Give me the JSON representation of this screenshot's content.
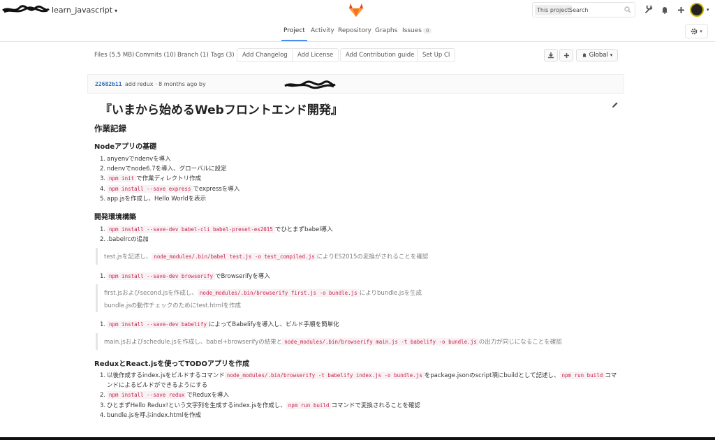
{
  "header": {
    "project_name": "learn_javascript",
    "search_scope": "This project",
    "search_placeholder": "Search"
  },
  "nav": {
    "tabs": [
      {
        "label": "Project"
      },
      {
        "label": "Activity"
      },
      {
        "label": "Repository"
      },
      {
        "label": "Graphs"
      },
      {
        "label": "Issues"
      }
    ],
    "issues_count": "0"
  },
  "stats": {
    "files": "Files (5.5 MB)",
    "commits": "Commits (10)",
    "branch": "Branch (1)",
    "tags": "Tags (3)"
  },
  "actions": {
    "add_changelog": "Add Changelog",
    "add_license": "Add License",
    "add_contribution": "Add Contribution guide",
    "setup_ci": "Set Up CI",
    "global": "Global"
  },
  "commit": {
    "sha": "22682b11",
    "message": "add redux · 8 months ago by"
  },
  "readme": {
    "title": "『いまから始めるWebフロントエンド開発』",
    "h_record": "作業記録",
    "h_node": "Nodeアプリの基礎",
    "node_items": [
      {
        "n": "1.",
        "pre": "anyenvでndenvを導入",
        "code": "",
        "post": ""
      },
      {
        "n": "2.",
        "pre": "ndenvでnode6.7を導入、グローバルに設定",
        "code": "",
        "post": ""
      },
      {
        "n": "3.",
        "pre": "",
        "code": "npm init",
        "post": "で作業ディレクトリ作成"
      },
      {
        "n": "4.",
        "pre": "",
        "code": "npm install --save express",
        "post": "でexpressを導入"
      },
      {
        "n": "5.",
        "pre": "app.jsを作成し、Hello Worldを表示",
        "code": "",
        "post": ""
      }
    ],
    "h_dev": "開発環境構築",
    "dev_item1": {
      "n": "1.",
      "code": "npm install --save-dev babel-cli babel-preset-es2015",
      "post": "でひとまずbabel導入"
    },
    "dev_item2": {
      "n": "2.",
      "text": ".babelrcの追加"
    },
    "quote1": {
      "pre": "test.jsを記述し、",
      "code": "node_modules/.bin/babel test.js -o test_compiled.js",
      "post": "によりES2015の変換がされることを確認"
    },
    "browserify_item": {
      "n": "1.",
      "code": "npm install --save-dev browserify",
      "post": "でBrowserifyを導入"
    },
    "quote2": {
      "pre": "first.jsおよびsecond.jsを作成し、",
      "code": "node_modules/.bin/browserify first.js  -o bundle.js",
      "post": "によりbundle.jsを生成",
      "line2": "bundle.jsの動作チェックのためにtest.htmlを作成"
    },
    "babelify_item": {
      "n": "1.",
      "code": "npm install --save-dev babelify",
      "post": "によってBabelifyを導入し、ビルド手順を簡単化"
    },
    "quote3": {
      "pre": "main.jsおよびschedule.jsを作成し、babel+browserifyの結果と",
      "code": "node_modules/.bin/browserify main.js -t babelify -o bundle.js",
      "post": "の出力が同じになることを確認"
    },
    "h_redux": "ReduxとReact.jsを使ってTODOアプリを作成",
    "redux_item1": {
      "n": "1.",
      "pre": "以後作成するindex.jsをビルドするコマンド",
      "code": "node_modules/.bin/browserify -t babelify index.js -o bundle.js",
      "mid": "をpackage.jsonのscript項にbuildとして記述し、",
      "code2": "npm run build",
      "post": "コマ",
      "line2": "ンドによるビルドができるようにする"
    },
    "redux_item2": {
      "n": "2.",
      "code": "npm install --save redux",
      "post": "でReduxを導入"
    },
    "redux_item3": {
      "n": "3.",
      "pre": "ひとまずHello Redux!という文字列を生成するindex.jsを作成し、",
      "code": "npm run build",
      "post": "コマンドで変換されることを確認"
    },
    "redux_item4": {
      "n": "4.",
      "text": "bundle.jsを呼ぶindex.htmlを作成"
    }
  },
  "colors": {
    "accent": "#4a8bee",
    "code": "#c7254e",
    "code_bg": "#f9f2f4",
    "sha": "#2e6fb7",
    "gitlab_orange": "#e24329"
  },
  "icons": [
    "gitlab-logo",
    "wrench-icon",
    "bell-icon",
    "plus-icon",
    "gear-icon",
    "download-icon",
    "pencil-icon",
    "search-icon"
  ]
}
